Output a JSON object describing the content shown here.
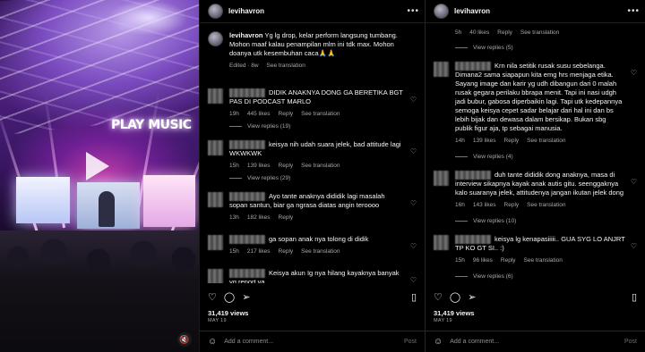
{
  "video": {
    "logo_text": "PLAY MUSIC",
    "mute_glyph": "🔇"
  },
  "panel1": {
    "username": "levihavron",
    "caption": {
      "username": "levihavron",
      "text": "Yg lg drop, kelar perform langsung tumbang. Mohon maaf kalau penampilan mlm ini tdk max. Mohon doanya utk kesembuhan caca🙏🙏",
      "edited": "Edited · 8w",
      "see_translation": "See translation"
    },
    "comments": [
      {
        "text": "DIDIK ANAKNYA DONG GA BERETIKA BGT PAS DI PODCAST MARLO",
        "time": "19h",
        "likes": "445 likes",
        "reply": "Reply",
        "see_translation": "See translation",
        "view_replies": "View replies (19)"
      },
      {
        "text": "keisya nih udah suara jelek, bad attitude lagi WKWKWK",
        "time": "15h",
        "likes": "139 likes",
        "reply": "Reply",
        "see_translation": "See translation",
        "view_replies": "View replies (29)"
      },
      {
        "text": "Ayo tante anaknya dididik lagi masalah sopan santun, biar ga ngrasa diatas angin teroooo",
        "time": "13h",
        "likes": "182 likes",
        "reply": "Reply",
        "see_translation": "",
        "view_replies": ""
      },
      {
        "text": "ga sopan anak nya tolong di didik",
        "time": "15h",
        "likes": "217 likes",
        "reply": "Reply",
        "see_translation": "See translation",
        "view_replies": ""
      },
      {
        "text": "Keisya akun Ig nya hilang kayaknya banyak yg report ya",
        "time": "",
        "likes": "",
        "reply": "",
        "see_translation": "",
        "view_replies": ""
      }
    ],
    "views": "31,419 views",
    "date": "MAY 19",
    "add_comment": "Add a comment...",
    "post": "Post"
  },
  "panel2": {
    "username": "levihavron",
    "top_meta": {
      "time": "5h",
      "likes": "40 likes",
      "reply": "Reply",
      "see_translation": "See translation",
      "view_replies": "View replies (5)"
    },
    "comments": [
      {
        "text": "Krn nila setitik rusak susu sebelanga. Dimana2 sama siapapun kita emg hrs menjaga etika. Sayang image dan karir yg udh dibangun dari 0 malah rusak gegara perilaku bbrapa menit. Tapi ini nasi udgh jadi bubur, gabosa diperbaikin lagi. Tapi utk kedepannya semoga keisya cepet sadar belajar dari hal ini dan bs lebih bijak dan dewasa dalam bersikap. Bukan sbg publik figur aja, tp sebagai manusia.",
        "time": "14h",
        "likes": "139 likes",
        "reply": "Reply",
        "see_translation": "See translation",
        "view_replies": "View replies (4)"
      },
      {
        "text": "duh tante dididik dong anaknya, masa di interview sikapnya kayak anak autis gitu. seenggaknya kalo suaranya jelek, attitudenya jangan ikutan jelek dong",
        "time": "16h",
        "likes": "143 likes",
        "reply": "Reply",
        "see_translation": "See translation",
        "view_replies": "View replies (10)"
      },
      {
        "text": "keisya lg kenapasiiiii.. GUA SYG LO ANJRT TP KO GT SI.. :)",
        "time": "15h",
        "likes": "96 likes",
        "reply": "Reply",
        "see_translation": "See translation",
        "view_replies": "View replies (6)"
      }
    ],
    "views": "31,419 views",
    "date": "MAY 19",
    "add_comment": "Add a comment...",
    "post": "Post"
  },
  "icons": {
    "heart": "♡",
    "comment": "◯",
    "share": "➢",
    "bookmark": "▯",
    "dots": "•••",
    "emoji": "☺"
  }
}
